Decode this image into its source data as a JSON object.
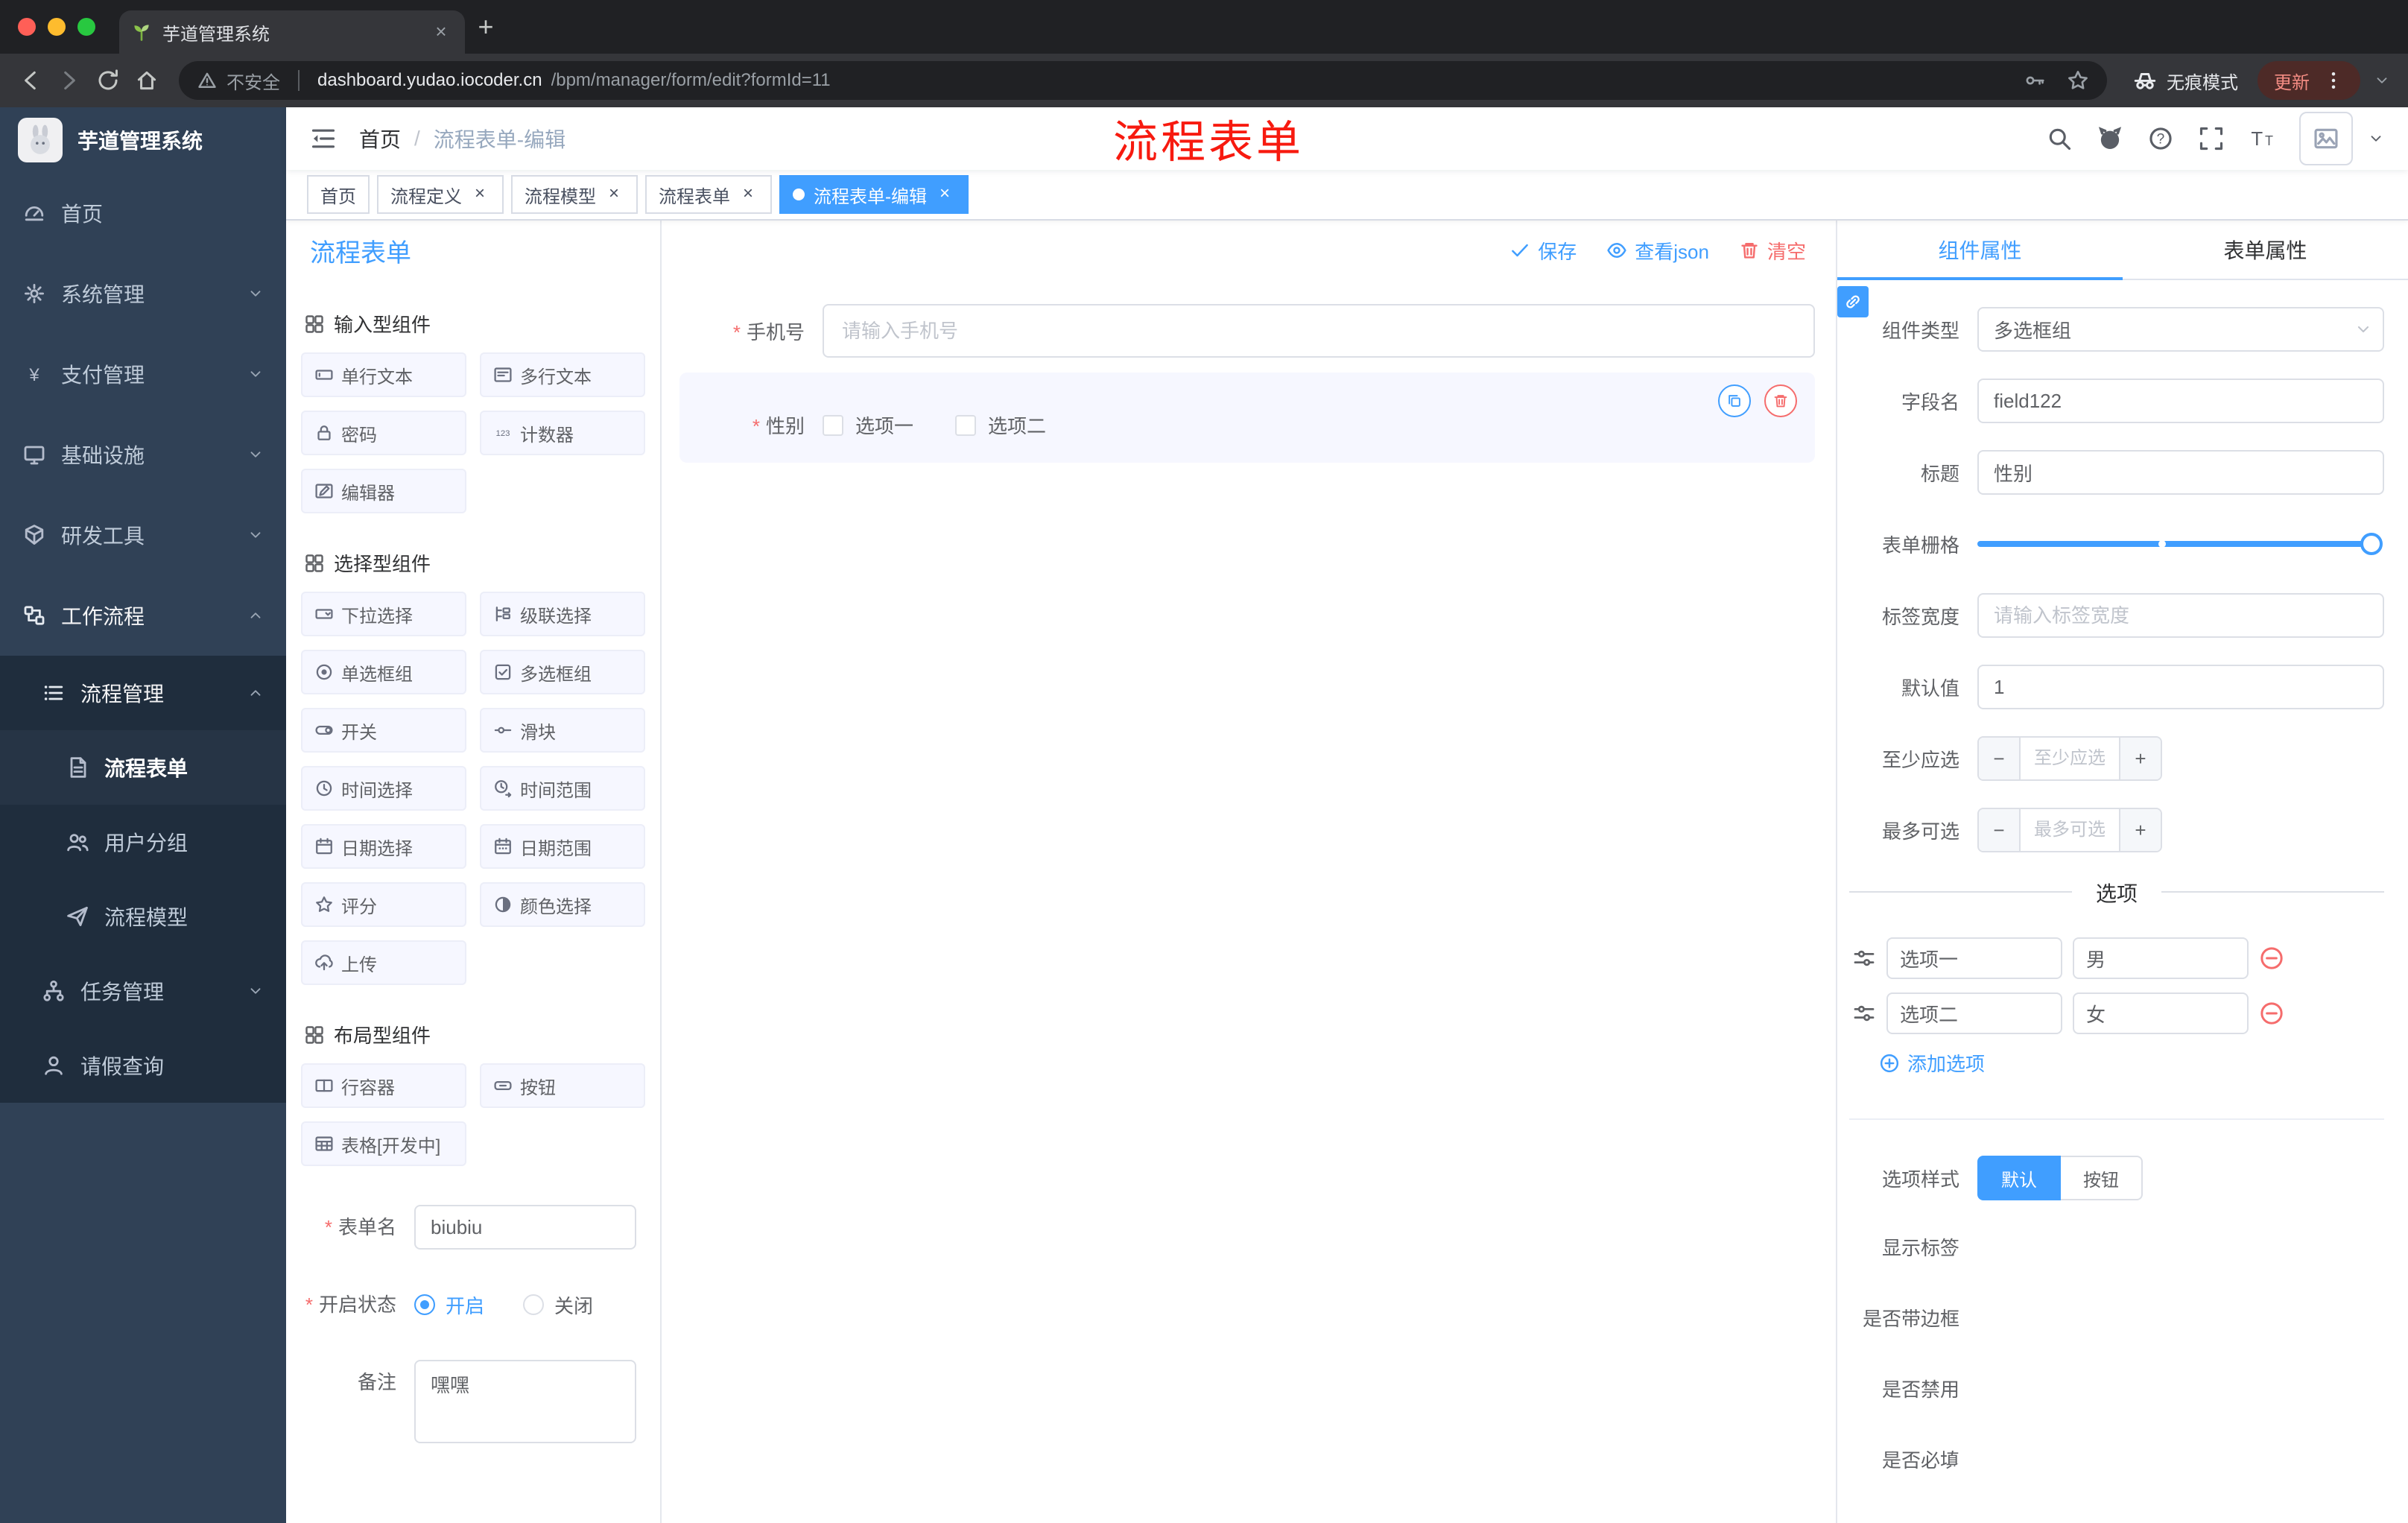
{
  "colors": {
    "accent": "#409eff",
    "danger": "#f56c6c",
    "sidebar_bg": "#304156",
    "submenu_bg": "#1f2d3d"
  },
  "browser": {
    "tab_title": "芋道管理系统",
    "security_label": "不安全",
    "url_host": "dashboard.yudao.iocoder.cn",
    "url_path": "/bpm/manager/form/edit?formId=11",
    "incognito_label": "无痕模式",
    "update_label": "更新"
  },
  "icons": {
    "help_glyph": "?",
    "font_large_glyph": "T",
    "font_small_glyph": "T",
    "counter_glyph": "123",
    "yen_glyph": "¥",
    "minus_glyph": "−",
    "plus_glyph": "+"
  },
  "sidebar": {
    "brand": "芋道管理系统",
    "home": "首页",
    "system": "系统管理",
    "payment": "支付管理",
    "infra": "基础设施",
    "devtools": "研发工具",
    "workflow": "工作流程",
    "process_mgmt": "流程管理",
    "process_form": "流程表单",
    "user_group": "用户分组",
    "process_model": "流程模型",
    "task_mgmt": "任务管理",
    "leave_query": "请假查询"
  },
  "header": {
    "breadcrumb_home": "首页",
    "breadcrumb_sep": "/",
    "breadcrumb_current": "流程表单-编辑",
    "annotation": "流程表单"
  },
  "tags": [
    {
      "label": "首页"
    },
    {
      "label": "流程定义"
    },
    {
      "label": "流程模型"
    },
    {
      "label": "流程表单"
    },
    {
      "label": "流程表单-编辑"
    }
  ],
  "designer": {
    "title": "流程表单",
    "groups": [
      {
        "title": "输入型组件"
      },
      {
        "title": "选择型组件"
      },
      {
        "title": "布局型组件"
      }
    ],
    "input_items": [
      "单行文本",
      "多行文本",
      "密码",
      "计数器",
      "编辑器"
    ],
    "select_items": [
      "下拉选择",
      "级联选择",
      "单选框组",
      "多选框组",
      "开关",
      "滑块",
      "时间选择",
      "时间范围",
      "日期选择",
      "日期范围",
      "评分",
      "颜色选择",
      "上传"
    ],
    "layout_items": [
      "行容器",
      "按钮",
      "表格[开发中]"
    ],
    "form": {
      "name_label": "表单名",
      "name_value": "biubiu",
      "status_label": "开启状态",
      "status_on": "开启",
      "status_off": "关闭",
      "remark_label": "备注",
      "remark_value": "嘿嘿"
    }
  },
  "canvas": {
    "save": "保存",
    "view_json": "查看json",
    "clear": "清空",
    "phone_label": "手机号",
    "phone_placeholder": "请输入手机号",
    "gender_label": "性别",
    "gender_option1": "选项一",
    "gender_option2": "选项二"
  },
  "props": {
    "tab_component": "组件属性",
    "tab_form": "表单属性",
    "type_label": "组件类型",
    "type_value": "多选框组",
    "field_label": "字段名",
    "field_value": "field122",
    "title_label": "标题",
    "title_value": "性别",
    "grid_label": "表单栅格",
    "label_width_label": "标签宽度",
    "label_width_placeholder": "请输入标签宽度",
    "default_label": "默认值",
    "default_value": "1",
    "min_label": "至少应选",
    "min_placeholder": "至少应选",
    "max_label": "最多可选",
    "max_placeholder": "最多可选",
    "options_title": "选项",
    "options": [
      {
        "label": "选项一",
        "value": "男"
      },
      {
        "label": "选项二",
        "value": "女"
      }
    ],
    "add_option": "添加选项",
    "style_label": "选项样式",
    "style_default": "默认",
    "style_button": "按钮",
    "show_label_label": "显示标签",
    "border_label": "是否带边框",
    "disabled_label": "是否禁用",
    "required_label": "是否必填"
  }
}
